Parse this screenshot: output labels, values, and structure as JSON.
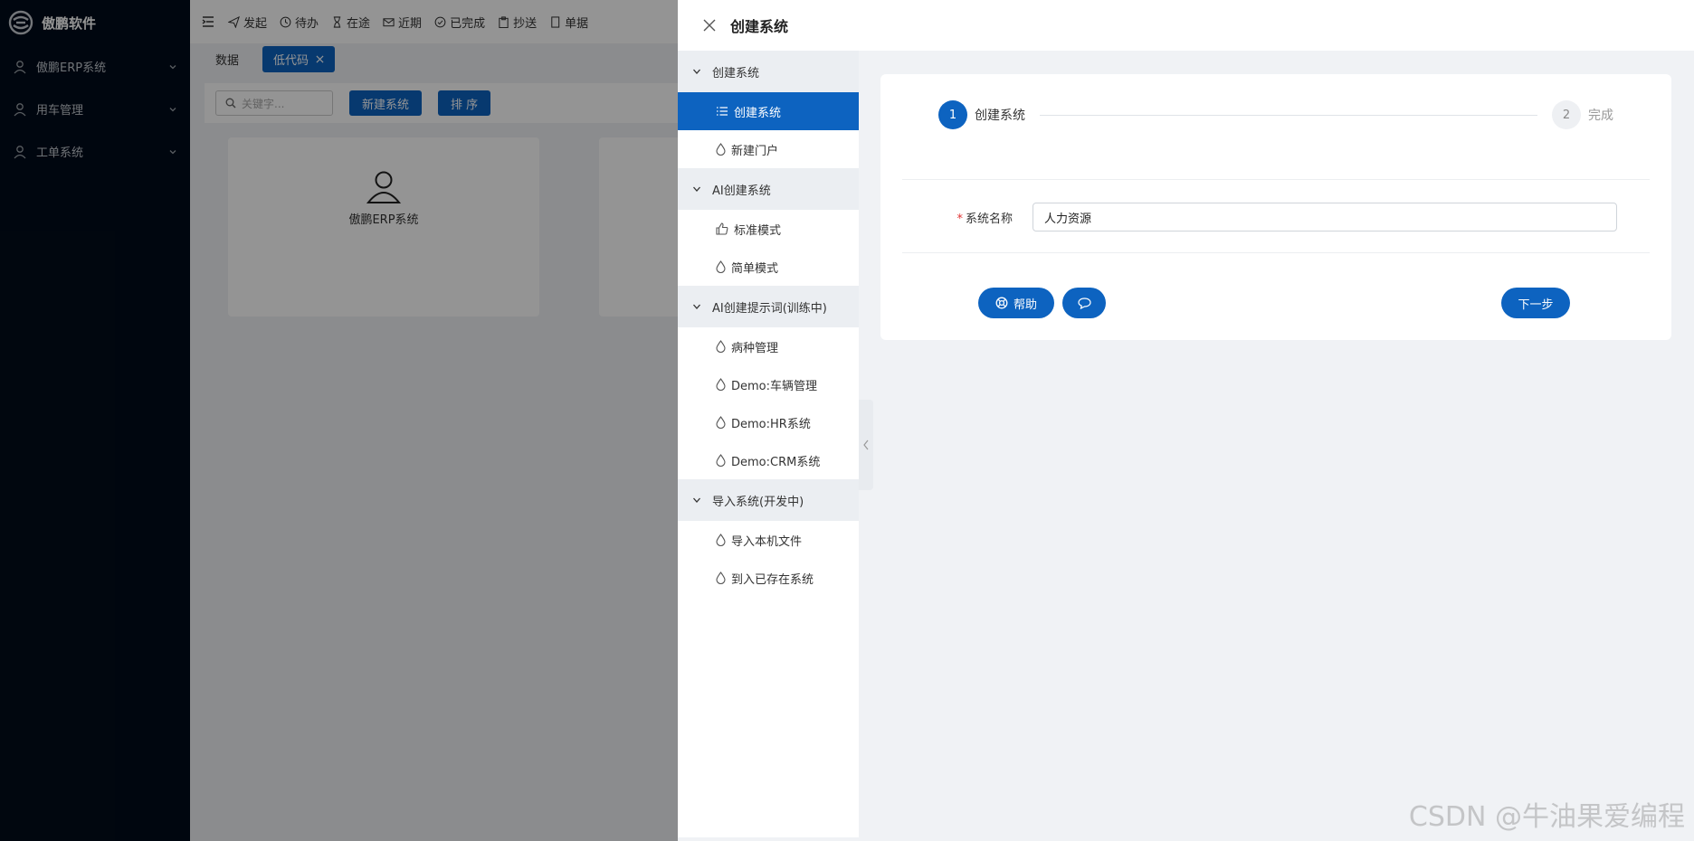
{
  "brand": {
    "name": "傲鹏软件"
  },
  "sidebar": {
    "items": [
      {
        "label": "傲鹏ERP系统"
      },
      {
        "label": "用车管理"
      },
      {
        "label": "工单系统"
      }
    ]
  },
  "topbar": {
    "items": [
      {
        "label": "发起"
      },
      {
        "label": "待办"
      },
      {
        "label": "在途"
      },
      {
        "label": "近期"
      },
      {
        "label": "已完成"
      },
      {
        "label": "抄送"
      },
      {
        "label": "单据"
      }
    ]
  },
  "tabs": [
    {
      "label": "数据"
    },
    {
      "label": "低代码"
    }
  ],
  "filter": {
    "keyword_placeholder": "关键字...",
    "new_system_label": "新建系统",
    "sort_label": "排 序"
  },
  "cards": [
    {
      "label": "傲鹏ERP系统"
    }
  ],
  "drawer": {
    "title": "创建系统",
    "menu": {
      "groups": [
        {
          "label": "创建系统",
          "items": [
            {
              "label": "创建系统",
              "active": true
            },
            {
              "label": "新建门户"
            }
          ]
        },
        {
          "label": "AI创建系统",
          "items": [
            {
              "label": "标准模式"
            },
            {
              "label": "简单模式"
            }
          ]
        },
        {
          "label": "AI创建提示词(训练中)",
          "items": [
            {
              "label": "病种管理"
            },
            {
              "label": "Demo:车辆管理"
            },
            {
              "label": "Demo:HR系统"
            },
            {
              "label": "Demo:CRM系统"
            }
          ]
        },
        {
          "label": "导入系统(开发中)",
          "items": [
            {
              "label": "导入本机文件"
            },
            {
              "label": "到入已存在系统"
            }
          ]
        }
      ]
    },
    "steps": [
      {
        "number": "1",
        "label": "创建系统"
      },
      {
        "number": "2",
        "label": "完成"
      }
    ],
    "form": {
      "required_mark": "*",
      "system_name_label": "系统名称",
      "system_name_value": "人力资源"
    },
    "actions": {
      "help_label": "帮助",
      "next_label": "下一步"
    }
  },
  "watermark": "CSDN @牛油果爱编程",
  "colors": {
    "accent": "#0d63c0",
    "sidebar_bg": "#010c1a",
    "drawer_bg": "#f0f2f5"
  }
}
